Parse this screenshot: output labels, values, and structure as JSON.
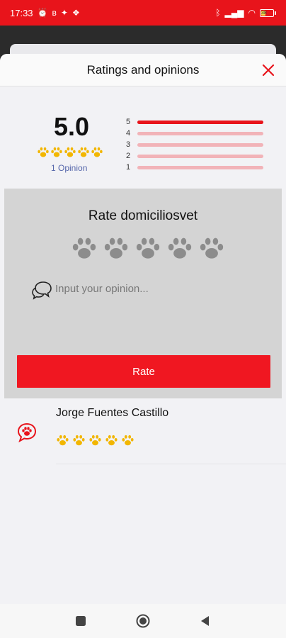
{
  "status_bar": {
    "time": "17:33",
    "battery_level": "38",
    "background_color": "#e8141b"
  },
  "dialog": {
    "title": "Ratings and opinions"
  },
  "summary": {
    "score": "5.0",
    "paw_rating": 5,
    "opinion_count": "1 Opinion",
    "distribution": [
      {
        "label": "5",
        "fraction": 1.0
      },
      {
        "label": "4",
        "fraction": 0.0
      },
      {
        "label": "3",
        "fraction": 0.0
      },
      {
        "label": "2",
        "fraction": 0.0
      },
      {
        "label": "1",
        "fraction": 0.0
      }
    ]
  },
  "rate_form": {
    "title": "Rate domiciliosvet",
    "paw_rating": 0,
    "opinion_value": "",
    "opinion_placeholder": "Input your opinion...",
    "submit_label": "Rate"
  },
  "reviews": [
    {
      "name": "Jorge Fuentes Castillo",
      "paw_rating": 5
    }
  ],
  "colors": {
    "accent": "#e8141b",
    "paw_filled": "#f2b600",
    "paw_empty": "#8c8c8c",
    "bar_empty": "#f2b3b8"
  },
  "icons": {
    "close": "close-icon",
    "paw": "paw-icon",
    "chat": "chat-bubbles-icon",
    "avatar": "paw-chat-avatar-icon",
    "nav_recents": "square-icon",
    "nav_home": "circle-icon",
    "nav_back": "triangle-back-icon"
  }
}
